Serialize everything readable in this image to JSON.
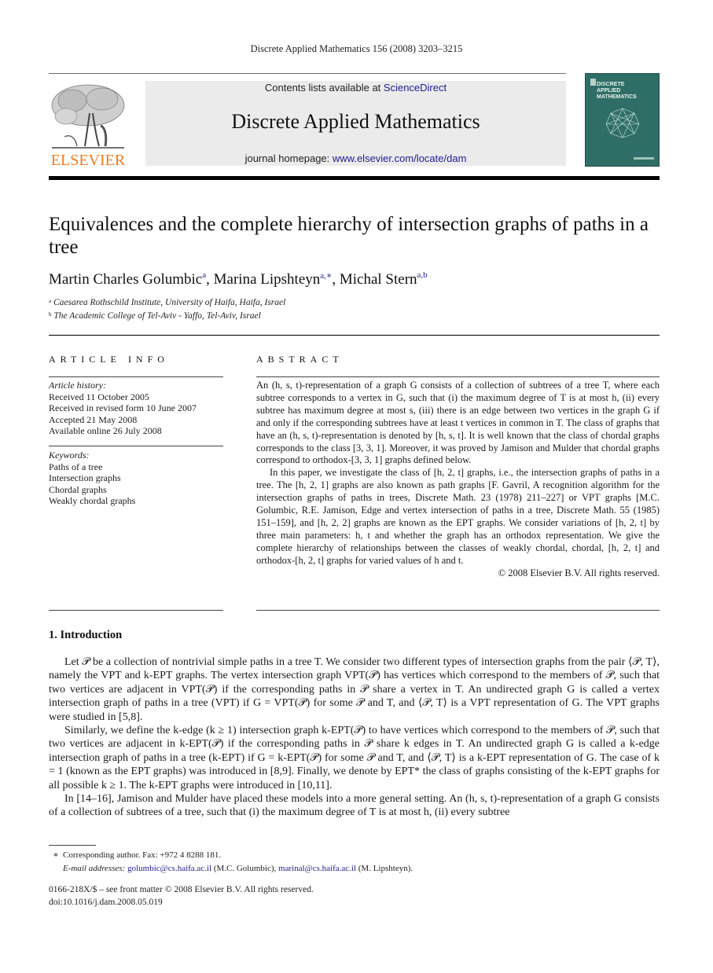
{
  "header": {
    "running_head": "Discrete Applied Mathematics 156 (2008) 3203–3215",
    "publisher_logo_text": "ELSEVIER",
    "contents_prefix": "Contents lists available at ",
    "contents_link": "ScienceDirect",
    "journal_title": "Discrete Applied Mathematics",
    "homepage_prefix": "journal homepage: ",
    "homepage_link": "www.elsevier.com/locate/dam",
    "cover_title_lines": [
      "DISCRETE",
      "APPLIED",
      "MATHEMATICS"
    ],
    "colors": {
      "elsevier_orange": "#f07d22",
      "link_blue": "#1f1f8a",
      "banner_gray": "#ebebeb",
      "cover_teal": "#2e6e66"
    }
  },
  "article": {
    "title": "Equivalences and the complete hierarchy of intersection graphs of paths in a tree",
    "authors": [
      {
        "name": "Martin Charles Golumbic",
        "sup": "a"
      },
      {
        "name": "Marina Lipshteyn",
        "sup": "a,∗"
      },
      {
        "name": "Michal Stern",
        "sup": "a,b"
      }
    ],
    "affiliations": [
      {
        "mark": "a",
        "text": "Caesarea Rothschild Institute, University of Haifa, Haifa, Israel"
      },
      {
        "mark": "b",
        "text": "The Academic College of Tel-Aviv - Yaffo, Tel-Aviv, Israel"
      }
    ]
  },
  "article_info": {
    "heading": "ARTICLE INFO",
    "history_label": "Article history:",
    "history": [
      "Received 11 October 2005",
      "Received in revised form 10 June 2007",
      "Accepted 21 May 2008",
      "Available online 26 July 2008"
    ],
    "keywords_label": "Keywords:",
    "keywords": [
      "Paths of a tree",
      "Intersection graphs",
      "Chordal graphs",
      "Weakly chordal graphs"
    ]
  },
  "abstract": {
    "heading": "ABSTRACT",
    "paragraphs": [
      "An (h, s, t)-representation of a graph G consists of a collection of subtrees of a tree T, where each subtree corresponds to a vertex in G, such that (i) the maximum degree of T is at most h, (ii) every subtree has maximum degree at most s, (iii) there is an edge between two vertices in the graph G if and only if the corresponding subtrees have at least t vertices in common in T. The class of graphs that have an (h, s, t)-representation is denoted by [h, s, t]. It is well known that the class of chordal graphs corresponds to the class [3, 3, 1]. Moreover, it was proved by Jamison and Mulder that chordal graphs correspond to orthodox-[3, 3, 1] graphs defined below.",
      "In this paper, we investigate the class of [h, 2, t] graphs, i.e., the intersection graphs of paths in a tree. The [h, 2, 1] graphs are also known as path graphs [F. Gavril, A recognition algorithm for the intersection graphs of paths in trees, Discrete Math. 23 (1978) 211–227] or VPT graphs [M.C. Golumbic, R.E. Jamison, Edge and vertex intersection of paths in a tree, Discrete Math. 55 (1985) 151–159], and [h, 2, 2] graphs are known as the EPT graphs. We consider variations of [h, 2, t] by three main parameters: h, t and whether the graph has an orthodox representation. We give the complete hierarchy of relationships between the classes of weakly chordal, chordal, [h, 2, t] and orthodox-[h, 2, t] graphs for varied values of h and t."
    ],
    "copyright": "© 2008 Elsevier B.V. All rights reserved."
  },
  "introduction": {
    "heading": "1.  Introduction",
    "paragraphs": [
      "Let 𝒫 be a collection of nontrivial simple paths in a tree T. We consider two different types of intersection graphs from the pair ⟨𝒫, T⟩, namely the VPT and k-EPT graphs. The vertex intersection graph VPT(𝒫) has vertices which correspond to the members of 𝒫, such that two vertices are adjacent in VPT(𝒫) if the corresponding paths in 𝒫 share a vertex in T. An undirected graph G is called a vertex intersection graph of paths in a tree (VPT) if G = VPT(𝒫) for some 𝒫 and T, and ⟨𝒫, T⟩ is a VPT representation of G. The VPT graphs were studied in [5,8].",
      "Similarly, we define the k-edge (k ≥ 1) intersection graph k-EPT(𝒫) to have vertices which correspond to the members of 𝒫, such that two vertices are adjacent in k-EPT(𝒫) if the corresponding paths in 𝒫 share k edges in T. An undirected graph G is called a k-edge intersection graph of paths in a tree (k-EPT) if G = k-EPT(𝒫) for some 𝒫 and T, and ⟨𝒫, T⟩ is a k-EPT representation of G. The case of k = 1 (known as the EPT graphs) was introduced in [8,9]. Finally, we denote by EPT* the class of graphs consisting of the k-EPT graphs for all possible k ≥ 1. The k-EPT graphs were introduced in [10,11].",
      "In [14–16], Jamison and Mulder have placed these models into a more general setting. An (h, s, t)-representation of a graph G consists of a collection of subtrees of a tree, such that (i) the maximum degree of T is at most h, (ii) every subtree"
    ]
  },
  "footnotes": {
    "corresponding_mark": "∗",
    "corresponding_text": "Corresponding author. Fax: +972 4 8288 181.",
    "email_label": "E-mail addresses:",
    "emails": [
      {
        "address": "golumbic@cs.haifa.ac.il",
        "owner": "(M.C. Golumbic)"
      },
      {
        "address": "marinal@cs.haifa.ac.il",
        "owner": "(M. Lipshteyn)."
      }
    ],
    "front_matter": "0166-218X/$ – see front matter © 2008 Elsevier B.V. All rights reserved.",
    "doi": "doi:10.1016/j.dam.2008.05.019"
  }
}
